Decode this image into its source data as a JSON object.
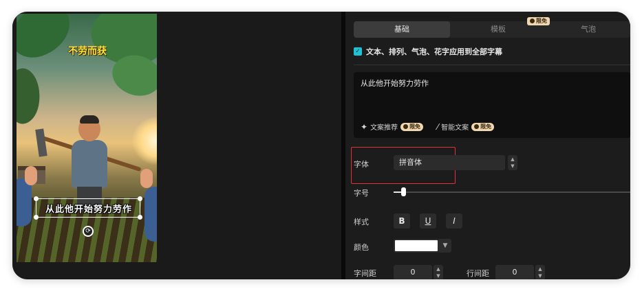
{
  "preview": {
    "title_overlay": "不劳而获",
    "subtitle": "从此他开始努力劳作"
  },
  "tabs": [
    {
      "label": "基础",
      "active": true
    },
    {
      "label": "模板",
      "active": false
    },
    {
      "label": "气泡",
      "active": false
    }
  ],
  "tab_badge": "限免",
  "apply_all": {
    "checked": true,
    "label": "文本、排列、气泡、花字应用到全部字幕"
  },
  "text_content": "从此他开始努力劳作",
  "actions": [
    {
      "icon": "sparkle-icon",
      "label": "文案推荐",
      "badge": "限免"
    },
    {
      "icon": "magic-wand-icon",
      "label": "智能文案",
      "badge": "限免"
    }
  ],
  "font": {
    "label": "字体",
    "value": "拼音体"
  },
  "size": {
    "label": "字号",
    "level": 0.04
  },
  "style": {
    "label": "样式",
    "bold": "B",
    "underline": "U",
    "italic": "I"
  },
  "color": {
    "label": "颜色",
    "value": "#ffffff"
  },
  "spacing": {
    "letter_label": "字间距",
    "letter_value": "0",
    "line_label": "行间距",
    "line_value": "0"
  },
  "colors": {
    "accent": "#1fc2d4",
    "highlight": "#e2313c",
    "badge": "#f1d7b0"
  }
}
